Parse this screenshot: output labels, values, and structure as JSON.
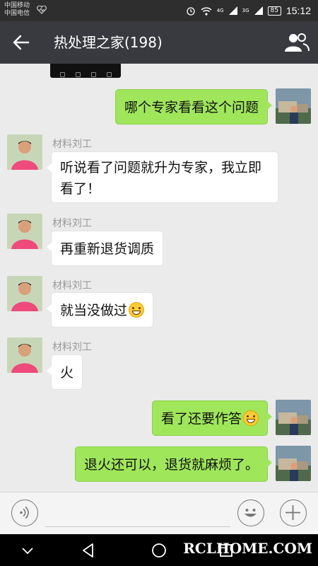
{
  "status_bar": {
    "carrier_1": "中国移动",
    "carrier_2": "中国电信",
    "network_1": "4G",
    "network_2": "3G",
    "battery": "85",
    "time": "15:12"
  },
  "header": {
    "title": "热处理之家(198)",
    "back_icon": "arrow-left-icon",
    "members_icon": "group-members-icon"
  },
  "messages": [
    {
      "direction": "out",
      "text": "哪个专家看看这个问题"
    },
    {
      "direction": "in",
      "sender": "材料刘工",
      "line1": "听说看了问题就升为专家，我立即",
      "line2": "看了！"
    },
    {
      "direction": "in",
      "sender": "材料刘工",
      "text": "再重新退货调质"
    },
    {
      "direction": "in",
      "sender": "材料刘工",
      "text": "就当没做过",
      "emoji": "grinning-face-emoji"
    },
    {
      "direction": "in",
      "sender": "材料刘工",
      "text": "火"
    },
    {
      "direction": "out",
      "text": "看了还要作答",
      "emoji": "grinning-face-emoji"
    },
    {
      "direction": "out",
      "text": "退火还可以，退货就麻烦了。"
    }
  ],
  "input_bar": {
    "voice_icon": "voice-input-icon",
    "emoji_icon": "emoji-icon",
    "more_icon": "plus-icon"
  },
  "nav_bar": {
    "icons": [
      "chevron-down-icon",
      "back-triangle-icon",
      "home-circle-icon",
      "recent-square-icon"
    ]
  },
  "watermark": "RCLHOME.COM",
  "colors": {
    "header_bg": "#393a3f",
    "chat_bg": "#ebebeb",
    "outgoing_bubble": "#9fe65a",
    "incoming_bubble": "#ffffff"
  }
}
